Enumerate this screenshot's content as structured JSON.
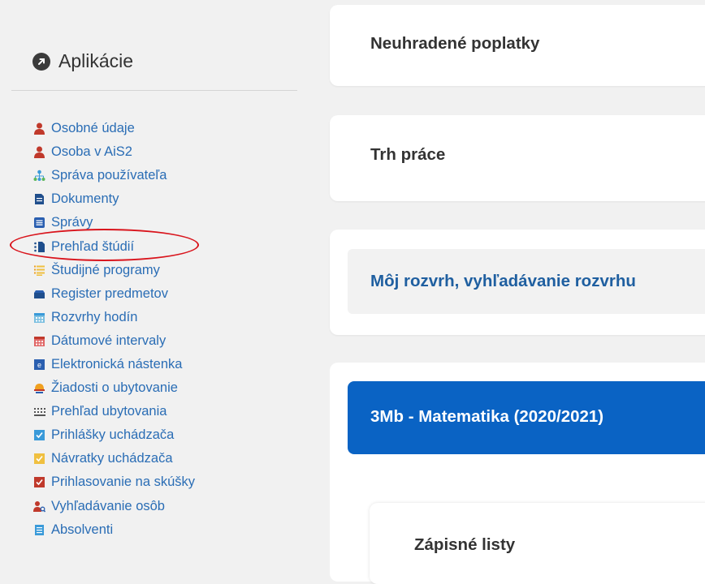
{
  "apps": {
    "title": "Aplikácie",
    "items": [
      {
        "label": "Osobné údaje",
        "icon": "person-icon"
      },
      {
        "label": "Osoba v AiS2",
        "icon": "person-icon"
      },
      {
        "label": "Správa používateľa",
        "icon": "user-tree-icon"
      },
      {
        "label": "Dokumenty",
        "icon": "document-icon"
      },
      {
        "label": "Správy",
        "icon": "messages-icon"
      },
      {
        "label": "Prehľad štúdií",
        "icon": "study-overview-icon"
      },
      {
        "label": "Študijné programy",
        "icon": "study-programs-icon"
      },
      {
        "label": "Register predmetov",
        "icon": "register-icon"
      },
      {
        "label": "Rozvrhy hodín",
        "icon": "calendar-icon"
      },
      {
        "label": "Dátumové intervaly",
        "icon": "date-interval-icon"
      },
      {
        "label": "Elektronická nástenka",
        "icon": "e-board-icon"
      },
      {
        "label": "Žiadosti o ubytovanie",
        "icon": "accommodation-request-icon"
      },
      {
        "label": "Prehľad ubytovania",
        "icon": "accommodation-overview-icon"
      },
      {
        "label": "Prihlášky uchádzača",
        "icon": "checkbox-blue-icon"
      },
      {
        "label": "Návratky uchádzača",
        "icon": "checkbox-yellow-icon"
      },
      {
        "label": "Prihlasovanie na skúšky",
        "icon": "checkbox-red-icon"
      },
      {
        "label": "Vyhľadávanie osôb",
        "icon": "person-search-icon"
      },
      {
        "label": "Absolventi",
        "icon": "graduates-icon"
      }
    ]
  },
  "cards": {
    "fees": "Neuhradené poplatky",
    "jobs": "Trh práce",
    "schedule": "Môj rozvrh, vyhľadávanie rozvrhu",
    "program": "3Mb - Matematika (2020/2021)",
    "enrollment": "Zápisné listy"
  },
  "colors": {
    "link": "#2a6db5",
    "banner": "#0a63c4",
    "highlight": "#d9141c"
  }
}
